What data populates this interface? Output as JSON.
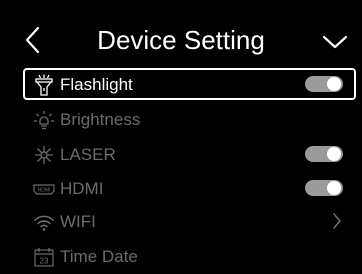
{
  "header": {
    "title": "Device Setting",
    "back_icon": "chevron-left-icon",
    "menu_icon": "chevron-down-icon"
  },
  "settings": [
    {
      "label": "Flashlight",
      "icon": "flashlight-icon",
      "control": "toggle",
      "on": true,
      "selected": true
    },
    {
      "label": "Brightness",
      "icon": "brightness-icon",
      "control": "none"
    },
    {
      "label": "LASER",
      "icon": "laser-icon",
      "control": "toggle",
      "on": true
    },
    {
      "label": "HDMI",
      "icon": "hdmi-icon",
      "icon_text": "HDMI",
      "control": "toggle",
      "on": true
    },
    {
      "label": "WIFI",
      "icon": "wifi-icon",
      "control": "chevron"
    },
    {
      "label": "Time Date",
      "icon": "calendar-icon",
      "icon_text": "23",
      "control": "none"
    }
  ],
  "colors": {
    "background": "#000000",
    "text_active": "#ffffff",
    "text_dim": "#6b6b6b",
    "toggle_track": "#9a9a9a",
    "toggle_knob": "#ffffff"
  }
}
